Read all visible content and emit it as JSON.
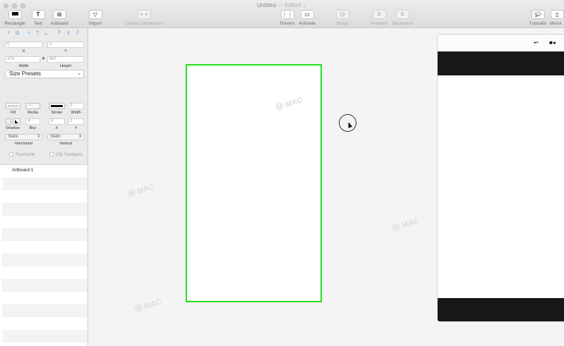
{
  "window": {
    "title": "Untitled",
    "edited": "— Edited ⌄"
  },
  "toolbar": {
    "rectangle": "Rectangle",
    "text": "Text",
    "artboard": "Artboard",
    "import": "Import",
    "create_component": "Create Component",
    "drivers": "Drivers",
    "animate": "Animate",
    "group": "Group",
    "forward": "Forward",
    "backward": "Backward",
    "tutorials": "Tutorials",
    "mirror": "Mirror"
  },
  "inspector": {
    "x_value": "0",
    "y_value": "0",
    "x_label": "X",
    "y_label": "Y",
    "width_value": "375",
    "height_value": "667",
    "width_label": "Width",
    "height_label": "Height",
    "size_presets": "Size Presets",
    "fill_label": "Fill",
    "media_label": "Media",
    "stroke_label": "Stroke",
    "stroke_width_value": "0",
    "stroke_width_label": "Width",
    "shadow_label": "Shadow",
    "blur_value": "4",
    "blur_label": "Blur",
    "shadow_x_value": "0",
    "shadow_y_value": "2",
    "shadow_x_label": "X",
    "shadow_y_label": "Y",
    "horizontal_value": "Static",
    "vertical_value": "Static",
    "horizontal_label": "Horizontal",
    "vertical_label": "Vertical",
    "touchable_label": "Touchable",
    "clip_sublayers_label": "Clip Sublayers"
  },
  "layers": {
    "items": [
      "Artboard 1"
    ]
  },
  "colors": {
    "artboard_border": "#22e01c",
    "accent": "#4a90e2",
    "dark_band": "#171717"
  }
}
